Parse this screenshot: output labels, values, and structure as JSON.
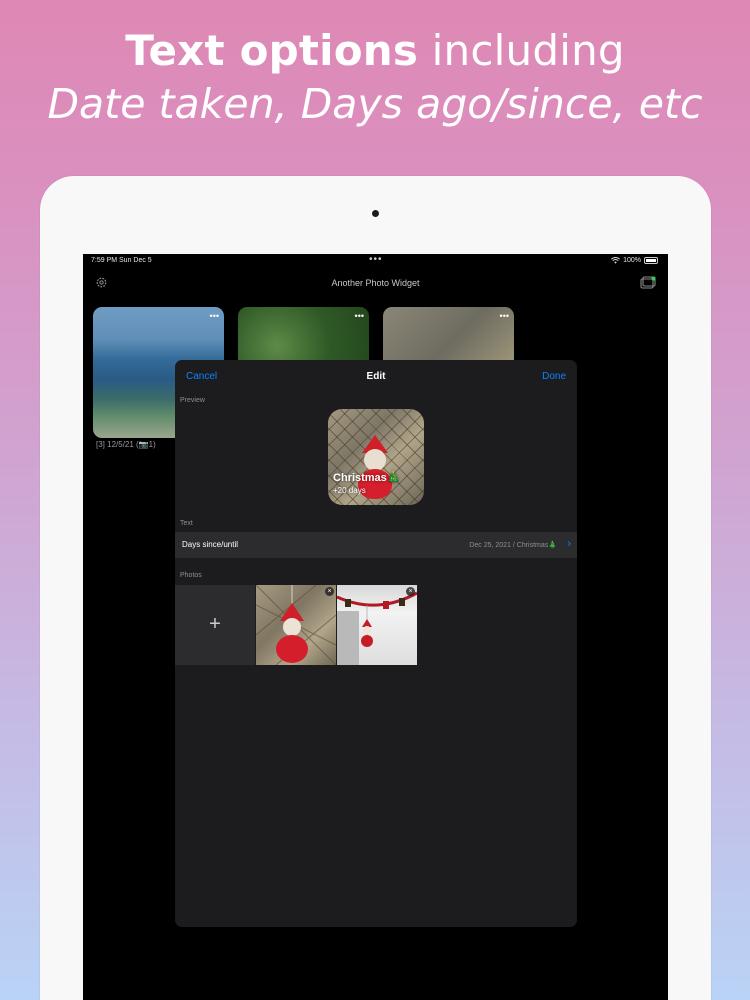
{
  "promo": {
    "line1_bold": "Text options",
    "line1_rest": " including",
    "line2_a": "Date taken",
    "line2_b": ", ",
    "line2_c": "Days ago/since",
    "line2_d": ", etc"
  },
  "status_bar": {
    "time": "7:59 PM   Sun Dec 5",
    "dots": "•••",
    "battery": "100%"
  },
  "app": {
    "title": "Another Photo Widget",
    "gear_icon": "gear-icon",
    "gallery_icon": "gallery-icon",
    "thumbnail_more": "•••",
    "thumbnail_caption": "[3] 12/5/21 (📷1)"
  },
  "modal": {
    "cancel_label": "Cancel",
    "title": "Edit",
    "done_label": "Done",
    "preview_section": "Preview",
    "preview_title": "Christmas🎄",
    "preview_sub": "+20 days",
    "text_section": "Text",
    "text_row_label": "Days since/until",
    "text_row_value": "Dec 25, 2021 / Christmas🎄",
    "chevron": "›",
    "photos_section": "Photos",
    "add_photo": "+",
    "remove_icon": "×"
  },
  "colors": {
    "accent": "#0a84ff",
    "modal_bg": "#1c1c1e",
    "row_bg": "#2c2c2e"
  }
}
